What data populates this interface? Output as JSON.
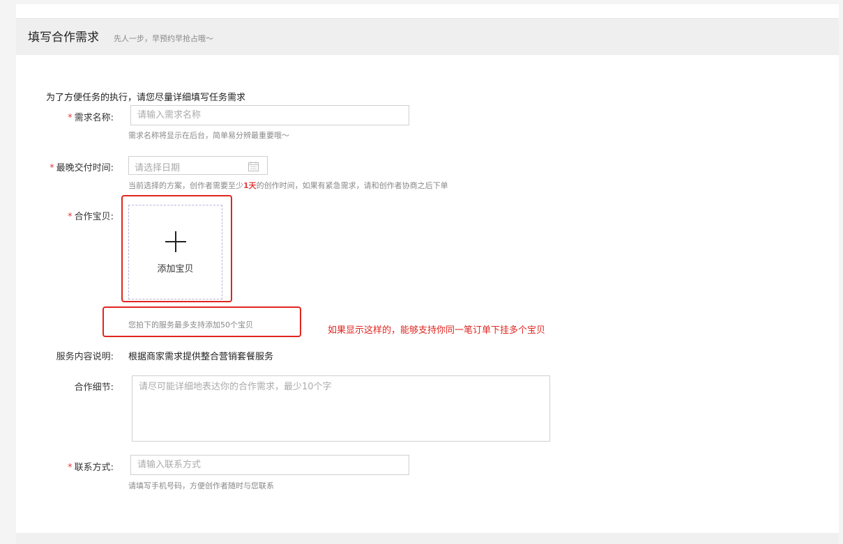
{
  "header": {
    "title": "填写合作需求",
    "subtitle": "先人一步，早预约早抢占哦～"
  },
  "form": {
    "intro": "为了方便任务的执行，请您尽量详细填写任务需求",
    "required_mark": "*",
    "name": {
      "label": "需求名称:",
      "placeholder": "请输入需求名称",
      "hint": "需求名称将显示在后台，简单易分辨最重要哦～"
    },
    "deadline": {
      "label": "最晚交付时间:",
      "placeholder": "请选择日期",
      "hint_prefix": "当前选择的方案，创作者需要至少",
      "hint_days": "1天",
      "hint_suffix": "的创作时间，如果有紧急需求，请和创作者协商之后下单",
      "icon": "calendar-icon"
    },
    "products": {
      "label": "合作宝贝:",
      "add_label": "添加宝贝",
      "icon": "plus-icon",
      "hint": "您拍下的服务最多支持添加50个宝贝"
    },
    "service": {
      "label": "服务内容说明:",
      "value": "根据商家需求提供整合营销套餐服务"
    },
    "details": {
      "label": "合作细节:",
      "placeholder": "请尽可能详细地表达你的合作需求，最少10个字"
    },
    "contact": {
      "label": "联系方式:",
      "placeholder": "请输入联系方式",
      "hint": "请填写手机号码，方便创作者随时与您联系"
    }
  },
  "annotation": {
    "text": "如果显示这样的，能够支持你同一笔订单下挂多个宝贝",
    "color": "#e0251f"
  }
}
